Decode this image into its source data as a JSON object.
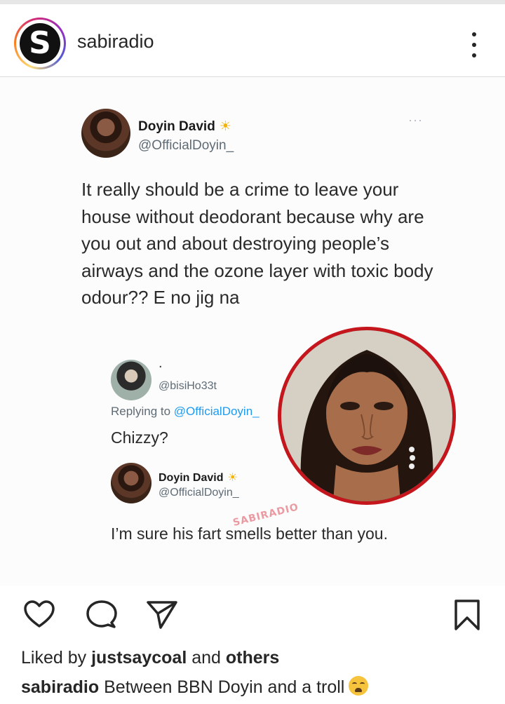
{
  "header": {
    "avatar_letter": "S",
    "username": "sabiradio"
  },
  "tweet": {
    "author_name": "Doyin David",
    "author_handle": "@OfficialDoyin_",
    "verified_emoji": "☀",
    "more": "···",
    "text": "It really should be a crime to leave your house without deodorant because why are you out and about destroying people’s airways and the ozone layer with toxic body odour?? E no jig na"
  },
  "reply1": {
    "display_name": ".",
    "handle": "@bisiHo33t",
    "replying_prefix": "Replying to",
    "replying_mention": "@OfficialDoyin_",
    "text": "Chizzy?"
  },
  "reply2": {
    "author_name": "Doyin David",
    "author_handle": "@OfficialDoyin_",
    "text": "I’m sure his fart smells better than you."
  },
  "watermark": "SABIRADIO",
  "likes": {
    "prefix": "Liked by",
    "user": "justsaycoal",
    "middle": "and",
    "others": "others"
  },
  "caption": {
    "user": "sabiradio",
    "text": "Between BBN Doyin and a troll"
  },
  "icons": {
    "like": "heart-icon",
    "comment": "comment-bubble-icon",
    "share": "paper-plane-icon",
    "save": "bookmark-icon",
    "more": "more-vertical-icon",
    "caption_emoji": "weary-face-emoji"
  },
  "colors": {
    "accent_blue": "#1d9bf0",
    "photo_ring": "#c4161c",
    "watermark": "#e8828c"
  }
}
